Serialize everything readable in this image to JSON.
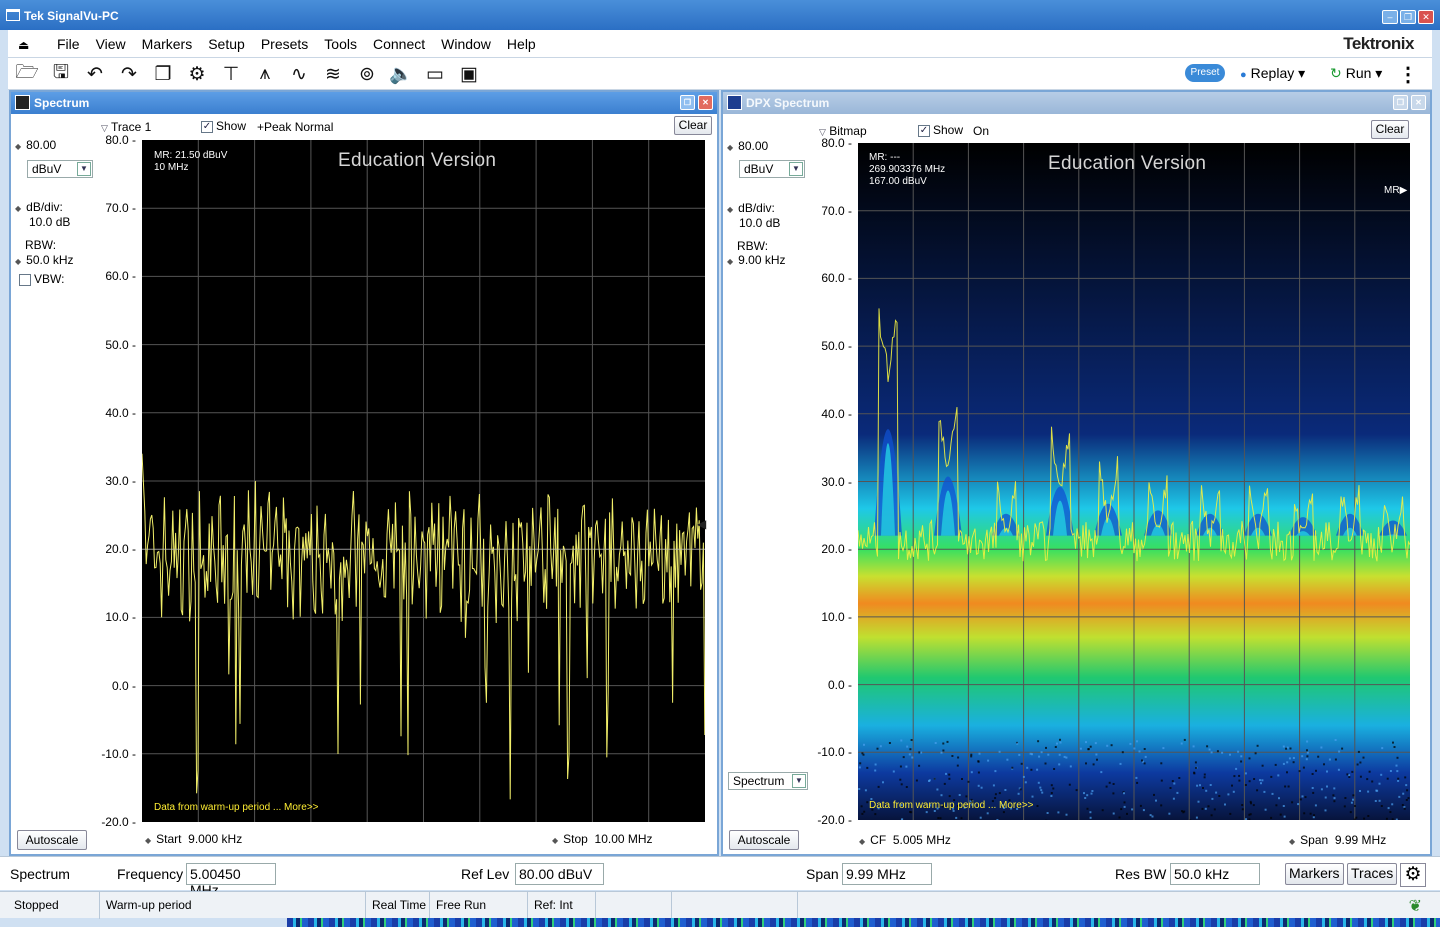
{
  "app": {
    "title": "Tek SignalVu-PC",
    "brand": "Tektronix"
  },
  "menu": [
    "File",
    "View",
    "Markers",
    "Setup",
    "Presets",
    "Tools",
    "Connect",
    "Window",
    "Help"
  ],
  "toolbar": {
    "icons": [
      "open-icon",
      "save-icon",
      "undo-icon",
      "redo-icon",
      "windows-icon",
      "gear-icon",
      "trigger-icon",
      "spectrum-icon",
      "dpx-icon",
      "spectrogram-icon",
      "antenna-icon",
      "speaker-icon",
      "camera-icon",
      "report-icon"
    ],
    "preset_label": "Preset",
    "replay_label": "Replay",
    "run_label": "Run"
  },
  "spectrum": {
    "title": "Spectrum",
    "ref_value": "80.00",
    "unit": "dBuV",
    "dbdiv_label": "dB/div:",
    "dbdiv_value": "10.0 dB",
    "rbw_label": "RBW:",
    "rbw_value": "50.0 kHz",
    "vbw_label": "VBW:",
    "trace_label": "Trace 1",
    "show_label": "Show",
    "detection_label": "+Peak Normal",
    "clear_label": "Clear",
    "autoscale_label": "Autoscale",
    "education": "Education Version",
    "marker_line1": "MR: 21.50 dBuV",
    "marker_line2": "10 MHz",
    "warmup": "Data from warm-up period ... More>>",
    "start_label": "Start",
    "start_value": "9.000 kHz",
    "stop_label": "Stop",
    "stop_value": "10.00 MHz",
    "y_ticks": [
      "80.0",
      "70.0",
      "60.0",
      "50.0",
      "40.0",
      "30.0",
      "20.0",
      "10.0",
      "0.0",
      "-10.0",
      "-20.0"
    ]
  },
  "dpx": {
    "title": "DPX Spectrum",
    "ref_value": "80.00",
    "unit": "dBuV",
    "dbdiv_label": "dB/div:",
    "dbdiv_value": "10.0 dB",
    "rbw_label": "RBW:",
    "rbw_value": "9.00 kHz",
    "bitmap_label": "Bitmap",
    "show_label": "Show",
    "on_label": "On",
    "clear_label": "Clear",
    "autoscale_label": "Autoscale",
    "view_select": "Spectrum",
    "education": "Education Version",
    "marker_line1": "MR: ---",
    "marker_line2": "269.903376 MHz",
    "marker_line3": "167.00 dBuV",
    "mr_flag": "MR",
    "warmup": "Data from warm-up period ... More>>",
    "cf_label": "CF",
    "cf_value": "5.005 MHz",
    "span_label": "Span",
    "span_value": "9.99 MHz",
    "y_ticks": [
      "80.0",
      "70.0",
      "60.0",
      "50.0",
      "40.0",
      "30.0",
      "20.0",
      "10.0",
      "0.0",
      "-10.0",
      "-20.0"
    ]
  },
  "bottom": {
    "mode": "Spectrum",
    "frequency_label": "Frequency",
    "frequency_value": "5.00450 MHz",
    "reflev_label": "Ref Lev",
    "reflev_value": "80.00 dBuV",
    "span_label": "Span",
    "span_value": "9.99 MHz",
    "resbw_label": "Res BW",
    "resbw_value": "50.0 kHz",
    "markers_label": "Markers",
    "traces_label": "Traces"
  },
  "status": {
    "state": "Stopped",
    "message": "Warm-up period",
    "realtime": "Real Time",
    "freerun": "Free Run",
    "ref": "Ref: Int"
  }
}
